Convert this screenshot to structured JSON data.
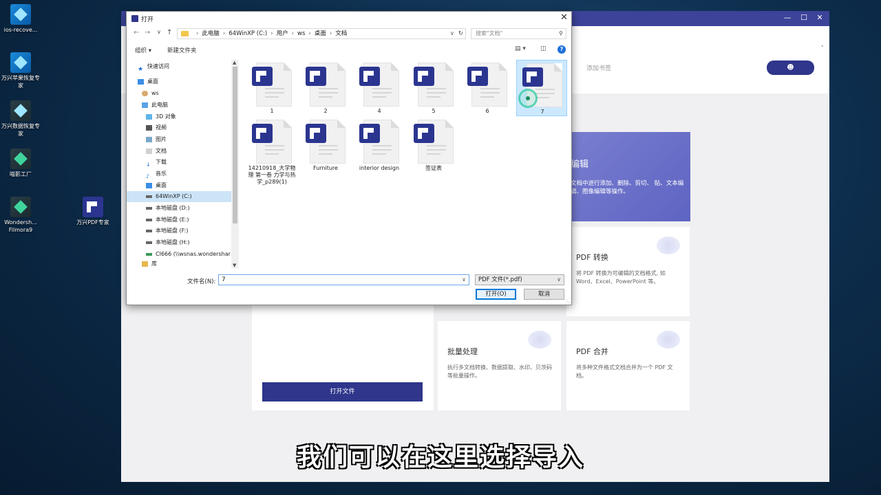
{
  "desktop": {
    "icons": [
      {
        "label": "ios-recove..."
      },
      {
        "label": "万兴苹果恢复专家"
      },
      {
        "label": "万兴数据恢复专家"
      },
      {
        "label": "喵影工厂"
      },
      {
        "label": "Wondersh... Filmora9"
      },
      {
        "label": "万兴PDF专家"
      }
    ]
  },
  "app": {
    "window_controls": {
      "minimize": "—",
      "maximize": "☐",
      "close": "✕"
    },
    "bookmark_label": "添加书签",
    "user_icon": "user-icon",
    "open_file_button": "打开文件",
    "edit_card": {
      "title": "编辑",
      "desc": "文档中进行添加、删除、剪切、 贴、文本编辑、图像编辑等操作。"
    },
    "features": [
      {
        "title": "PDF 转换",
        "desc": "将 PDF 转换为可编辑的文档格式, 如 Word、Excel、PowerPoint 等。"
      },
      {
        "title": "批量处理",
        "desc": "执行多文档转换、数据提取、水印、贝茨码等批量操作。"
      },
      {
        "title": "PDF 合并",
        "desc": "将多种文件格式文档合并为一个 PDF 文档。"
      }
    ],
    "accent_color": "#2f368b"
  },
  "dialog": {
    "title": "打开",
    "address": {
      "path": [
        "此电脑",
        "64WinXP (C:)",
        "用户",
        "ws",
        "桌面",
        "文档"
      ]
    },
    "search_placeholder": "搜索\"文档\"",
    "organize": "组织 ▾",
    "new_folder": "新建文件夹",
    "help": "?",
    "nav": [
      {
        "label": "快速访问",
        "icon": "star-icon"
      },
      {
        "label": "桌面",
        "icon": "desktop-icon"
      },
      {
        "label": "ws",
        "icon": "user-icon"
      },
      {
        "label": "此电脑",
        "icon": "computer-icon"
      },
      {
        "label": "3D 对象",
        "icon": "cube-icon"
      },
      {
        "label": "视频",
        "icon": "video-icon"
      },
      {
        "label": "图片",
        "icon": "picture-icon"
      },
      {
        "label": "文档",
        "icon": "document-icon"
      },
      {
        "label": "下载",
        "icon": "download-icon"
      },
      {
        "label": "音乐",
        "icon": "music-icon"
      },
      {
        "label": "桌面",
        "icon": "desktop-icon"
      },
      {
        "label": "64WinXP  (C:)",
        "icon": "drive-icon",
        "selected": true
      },
      {
        "label": "本地磁盘 (D:)",
        "icon": "drive-icon"
      },
      {
        "label": "本地磁盘 (E:)",
        "icon": "drive-icon"
      },
      {
        "label": "本地磁盘 (F:)",
        "icon": "drive-icon"
      },
      {
        "label": "本地磁盘 (H:)",
        "icon": "drive-icon"
      },
      {
        "label": "CI666 (\\\\wsnas.wondershar",
        "icon": "network-drive-icon"
      },
      {
        "label": "库",
        "icon": "library-icon"
      }
    ],
    "files": [
      {
        "name": "1"
      },
      {
        "name": "2"
      },
      {
        "name": "4"
      },
      {
        "name": "5"
      },
      {
        "name": "6"
      },
      {
        "name": "7",
        "selected": true
      },
      {
        "name": "14210918_大学物理 第一卷 力学与热学_p289(1)"
      },
      {
        "name": "Furniture"
      },
      {
        "name": "interior design"
      },
      {
        "name": "签证表"
      }
    ],
    "filename_label": "文件名(N):",
    "filename_value": "7",
    "filetype": "PDF 文件(*.pdf)",
    "open_button": "打开(O)",
    "cancel_button": "取消"
  },
  "subtitle": "我们可以在这里选择导入"
}
